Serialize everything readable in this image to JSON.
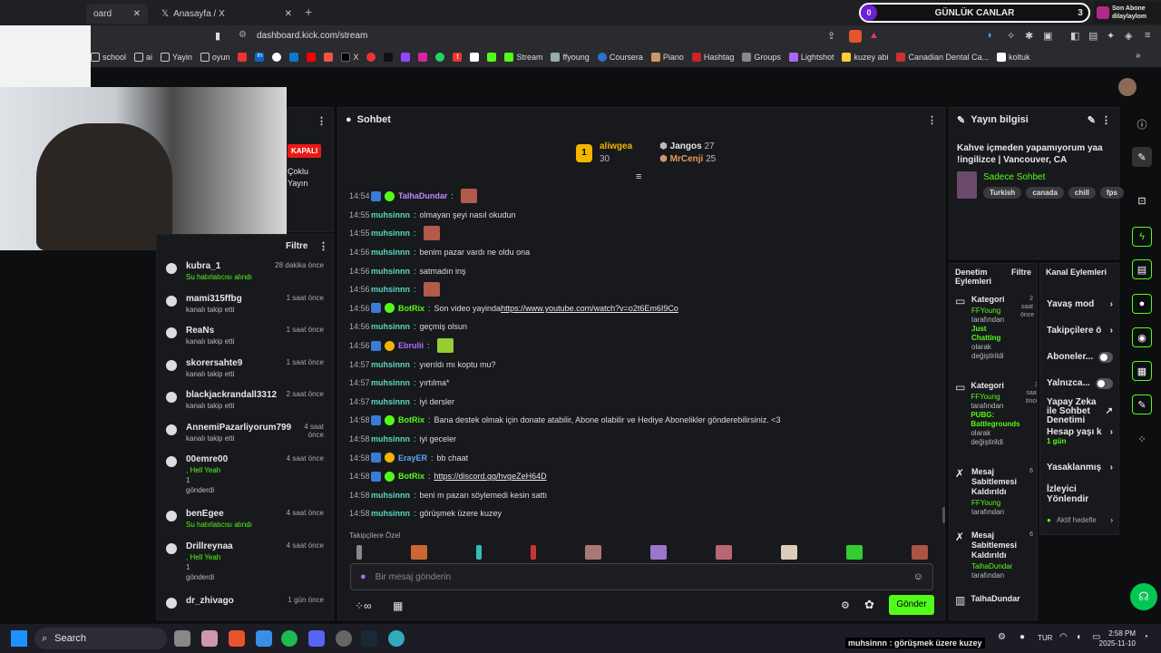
{
  "browser": {
    "tabs": [
      "oard",
      "Anasayfa / X"
    ],
    "new_tab": "+",
    "url": "dashboard.kick.com/stream",
    "bookmarks": [
      "school",
      "ai",
      "Yayin",
      "oyun",
      "in",
      "",
      "",
      "",
      "",
      "X",
      "",
      "",
      "",
      "",
      "t",
      "",
      "",
      "Stream",
      "ffyoung",
      "Coursera",
      "Piano",
      "Hashtag",
      "Groups",
      "Lightshot",
      "kuzey abi",
      "Canadian Dental Ca...",
      "koltuk"
    ]
  },
  "overlay": {
    "counter_left": "0",
    "title": "GÜNLÜK CANLAR",
    "counter_right": "3",
    "sub_label": "Son Abone",
    "sub_name": "dilaylaylom"
  },
  "stream_preview": {
    "status": "KAPALI",
    "multi": "Çoklu Yayın"
  },
  "activity": {
    "filter": "Filtre",
    "items": [
      {
        "name": "kubra_1",
        "sub": "Su hatırlatıcısı alındı",
        "time": "28 dakika önce",
        "green": true
      },
      {
        "name": "mami315ffbg",
        "sub": "kanalı takip etti",
        "time": "1 saat önce"
      },
      {
        "name": "ReaNs",
        "sub": "kanalı takip etti",
        "time": "1 saat önce"
      },
      {
        "name": "skorersahte9",
        "sub": "kanalı takip etti",
        "time": "1 saat önce"
      },
      {
        "name": "blackjackrandall3312",
        "sub": "kanalı takip etti",
        "time": "2 saat önce"
      },
      {
        "name": "AnnemiPazarliyorum799",
        "sub": "kanalı takip etti",
        "time": "4 saat önce"
      },
      {
        "name": "00emre00",
        "sub": ", Hell Yeah",
        "sub2": "1",
        "sub3": "gönderdi",
        "time": "4 saat önce",
        "green": true
      },
      {
        "name": "benEgee",
        "sub": "Su hatırlatıcısı alındı",
        "time": "4 saat önce",
        "green": true
      },
      {
        "name": "Drillreynaa",
        "sub": ", Hell Yeah",
        "sub2": "1",
        "sub3": "gönderdi",
        "time": "4 saat önce",
        "green": true
      },
      {
        "name": "dr_zhivago",
        "sub": "",
        "time": "1 gün önce"
      }
    ]
  },
  "chat": {
    "title": "Sohbet",
    "leaders": [
      {
        "name": "aliwgea",
        "value": "30"
      },
      {
        "name": "Jangos",
        "value": "27"
      },
      {
        "name": "MrCenji",
        "value": "25"
      }
    ],
    "messages": [
      {
        "t": "14:54",
        "u": "TalhaDundar",
        "c": "#c287ff",
        "text": "",
        "emote": true
      },
      {
        "t": "14:55",
        "u": "muhsinnn",
        "c": "#5ad7c3",
        "text": "olmayan şeyi nasıl okudun"
      },
      {
        "t": "14:55",
        "u": "muhsinnn",
        "c": "#5ad7c3",
        "text": "",
        "emote": true
      },
      {
        "t": "14:56",
        "u": "muhsinnn",
        "c": "#5ad7c3",
        "text": "benim pazar vardı ne oldu ona"
      },
      {
        "t": "14:56",
        "u": "muhsinnn",
        "c": "#5ad7c3",
        "text": "satmadın inş"
      },
      {
        "t": "14:56",
        "u": "muhsinnn",
        "c": "#5ad7c3",
        "text": "",
        "emote": true
      },
      {
        "t": "14:56",
        "u": "BotRix",
        "c": "#53fc18",
        "text": "Son video yayinda ",
        "link": "https://www.youtube.com/watch?v=o2t6Em6I9Co"
      },
      {
        "t": "14:56",
        "u": "muhsinnn",
        "c": "#5ad7c3",
        "text": "geçmiş olsun"
      },
      {
        "t": "14:56",
        "u": "Ebrulii",
        "c": "#b06cff",
        "text": "",
        "emote": true
      },
      {
        "t": "14:57",
        "u": "muhsinnn",
        "c": "#5ad7c3",
        "text": "yıerıldı mı koptu mu?"
      },
      {
        "t": "14:57",
        "u": "muhsinnn",
        "c": "#5ad7c3",
        "text": "yırtılma*"
      },
      {
        "t": "14:57",
        "u": "muhsinnn",
        "c": "#5ad7c3",
        "text": "iyi dersler"
      },
      {
        "t": "14:58",
        "u": "BotRix",
        "c": "#53fc18",
        "text": "Bana destek olmak için donate atabilir, Abone olabilir ve Hediye Abonelikler gönderebilirsiniz. <3"
      },
      {
        "t": "14:58",
        "u": "muhsinnn",
        "c": "#5ad7c3",
        "text": "iyi geceler"
      },
      {
        "t": "14:58",
        "u": "ErayER",
        "c": "#59a7ff",
        "text": "bb chaat"
      },
      {
        "t": "14:58",
        "u": "BotRix",
        "c": "#53fc18",
        "text": "",
        "link": "https://discord.gg/hvgeZeH64D"
      },
      {
        "t": "14:58",
        "u": "muhsinnn",
        "c": "#5ad7c3",
        "text": "beni m pazarı söylemedi kesin sattı"
      },
      {
        "t": "14:58",
        "u": "muhsinnn",
        "c": "#5ad7c3",
        "text": "görüşmek üzere kuzey"
      }
    ],
    "followers_only": "Takipçilere Özel",
    "placeholder": "Bir mesaj gönderin",
    "send": "Gönder"
  },
  "info": {
    "title": "Yayın bilgisi",
    "stream_title": "Kahve içmeden yapamıyorum yaa !ingilizce | Vancouver, CA",
    "category": "Sadece Sohbet",
    "tags": [
      "Turkish",
      "canada",
      "chill",
      "fps"
    ]
  },
  "mod": {
    "title": "Denetim Eylemleri",
    "filter": "Filtre",
    "items": [
      {
        "name": "Kategori",
        "time": "2 saat önce",
        "by": "FFYoung",
        "l1": "tarafından",
        "val": "Just Chatting",
        "l2": "olarak değiştirildi"
      },
      {
        "name": "Kategori",
        "time": "3 saat önce",
        "by": "FFYoung",
        "l1": "tarafından",
        "val": "PUBG: Battlegrounds",
        "l2": "olarak değiştirildi"
      },
      {
        "name": "Mesaj Sabitlemesi Kaldırıldı",
        "time": "6",
        "by": "FFYoung",
        "l1": "tarafından"
      },
      {
        "name": "Mesaj Sabitlemesi Kaldırıldı",
        "time": "6",
        "by": "TalhaDundar",
        "l1": "tarafından"
      },
      {
        "name": "TalhaDundar",
        "time": ""
      }
    ]
  },
  "channel": {
    "title": "Kanal Eylemleri",
    "items": [
      "Yavaş mod",
      "Takipçilere ö",
      "Aboneler...",
      "Yalnızca...",
      "Yapay Zeka ile Sohbet Denetimi",
      "Hesap yaşı k",
      "Yasaklanmış",
      "İzleyici Yönlendir",
      "Aktif hedefle"
    ],
    "age_val": "1 gün"
  },
  "taskbar": {
    "search": "Search",
    "ticker": "muhsinnn : görüşmek üzere kuzey",
    "lang": "TUR",
    "time": "2:58 PM",
    "date": "2025-11-10"
  }
}
